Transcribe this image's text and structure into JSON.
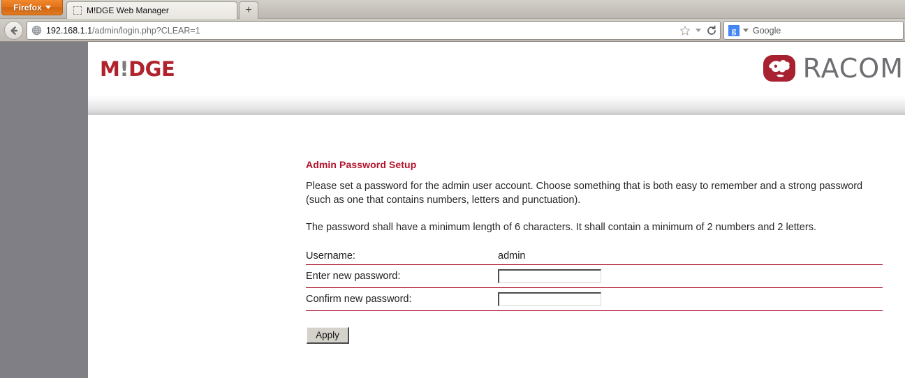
{
  "browser": {
    "app_button_label": "Firefox",
    "tab": {
      "title": "M!DGE Web Manager",
      "favicon": "dashed-placeholder-icon"
    },
    "new_tab_label": "+",
    "back_icon": "back-arrow-icon",
    "url": {
      "host": "192.168.1.1",
      "path": "/admin/login.php?CLEAR=1",
      "full": "192.168.1.1/admin/login.php?CLEAR=1",
      "favicon": "globe-icon"
    },
    "url_icons": [
      "bookmark-star-icon",
      "dropdown-caret-icon",
      "reload-icon"
    ],
    "search": {
      "engine_badge": "g",
      "engine_name": "Google",
      "placeholder": "Google"
    }
  },
  "site": {
    "brand_primary": "M!DGE",
    "brand_primary_parts": {
      "before": "M",
      "bang": "!",
      "after": "DGE"
    },
    "brand_secondary": "RACOM",
    "brand_secondary_icon": "racom-mark-icon",
    "colors": {
      "accent_red": "#b0232c",
      "title_red": "#b3112a",
      "rule_red": "#a80f28",
      "wordmark_gray": "#6e6e73",
      "gutter_gray": "#7f7f85"
    }
  },
  "content": {
    "title": "Admin Password Setup",
    "paragraph_1": "Please set a password for the admin user account. Choose something that is both easy to remember and a strong password (such as one that contains numbers, letters and punctuation).",
    "paragraph_2": "The password shall have a minimum length of 6 characters. It shall contain a minimum of 2 numbers and 2 letters.",
    "form": {
      "rows": [
        {
          "label": "Username:",
          "value": "admin",
          "type": "static"
        },
        {
          "label": "Enter new password:",
          "value": "",
          "type": "password"
        },
        {
          "label": "Confirm new password:",
          "value": "",
          "type": "password"
        }
      ],
      "apply_label": "Apply"
    }
  }
}
